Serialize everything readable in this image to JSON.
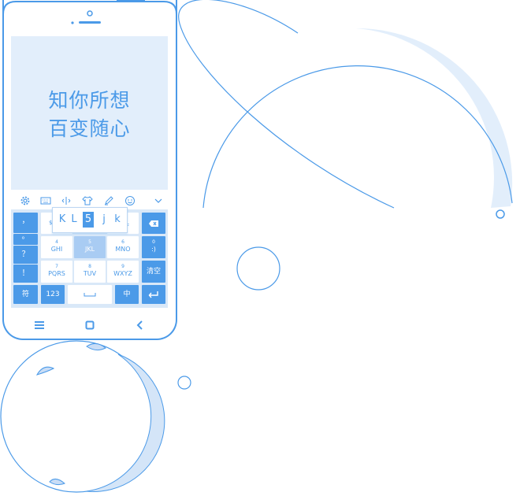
{
  "slogan": {
    "line1": "知你所想",
    "line2": "百变随心"
  },
  "toolbar": {
    "icons": [
      "gear-icon",
      "keyboard-icon",
      "cursor-move-icon",
      "tshirt-skin-icon",
      "pen-handwrite-icon",
      "emoji-icon",
      "chevron-down-icon"
    ]
  },
  "popup": {
    "letters": [
      "K",
      "L",
      "5",
      "j",
      "k"
    ],
    "selected_index": 2
  },
  "keyboard": {
    "left_column": [
      "，",
      "。",
      "？",
      "！"
    ],
    "keys": {
      "abc_partial": "$",
      "def_partial": "F",
      "k4_num": "4",
      "k4_letters": "GHI",
      "k5_num": "5",
      "k5_letters": "JKL",
      "k6_num": "6",
      "k6_letters": "MNO",
      "k7_num": "7",
      "k7_letters": "PQRS",
      "k8_num": "8",
      "k8_letters": "TUV",
      "k9_num": "9",
      "k9_letters": "WXYZ",
      "k0_num": "0",
      "k0_letters": ":)",
      "clear": "清空",
      "symbol": "符",
      "num": "123",
      "lang": "中"
    }
  },
  "colors": {
    "accent": "#4b9ae8",
    "screen_bg": "#e2eefb",
    "kbd_bg": "#d9e8f8",
    "highlight": "#a9ccf3"
  }
}
